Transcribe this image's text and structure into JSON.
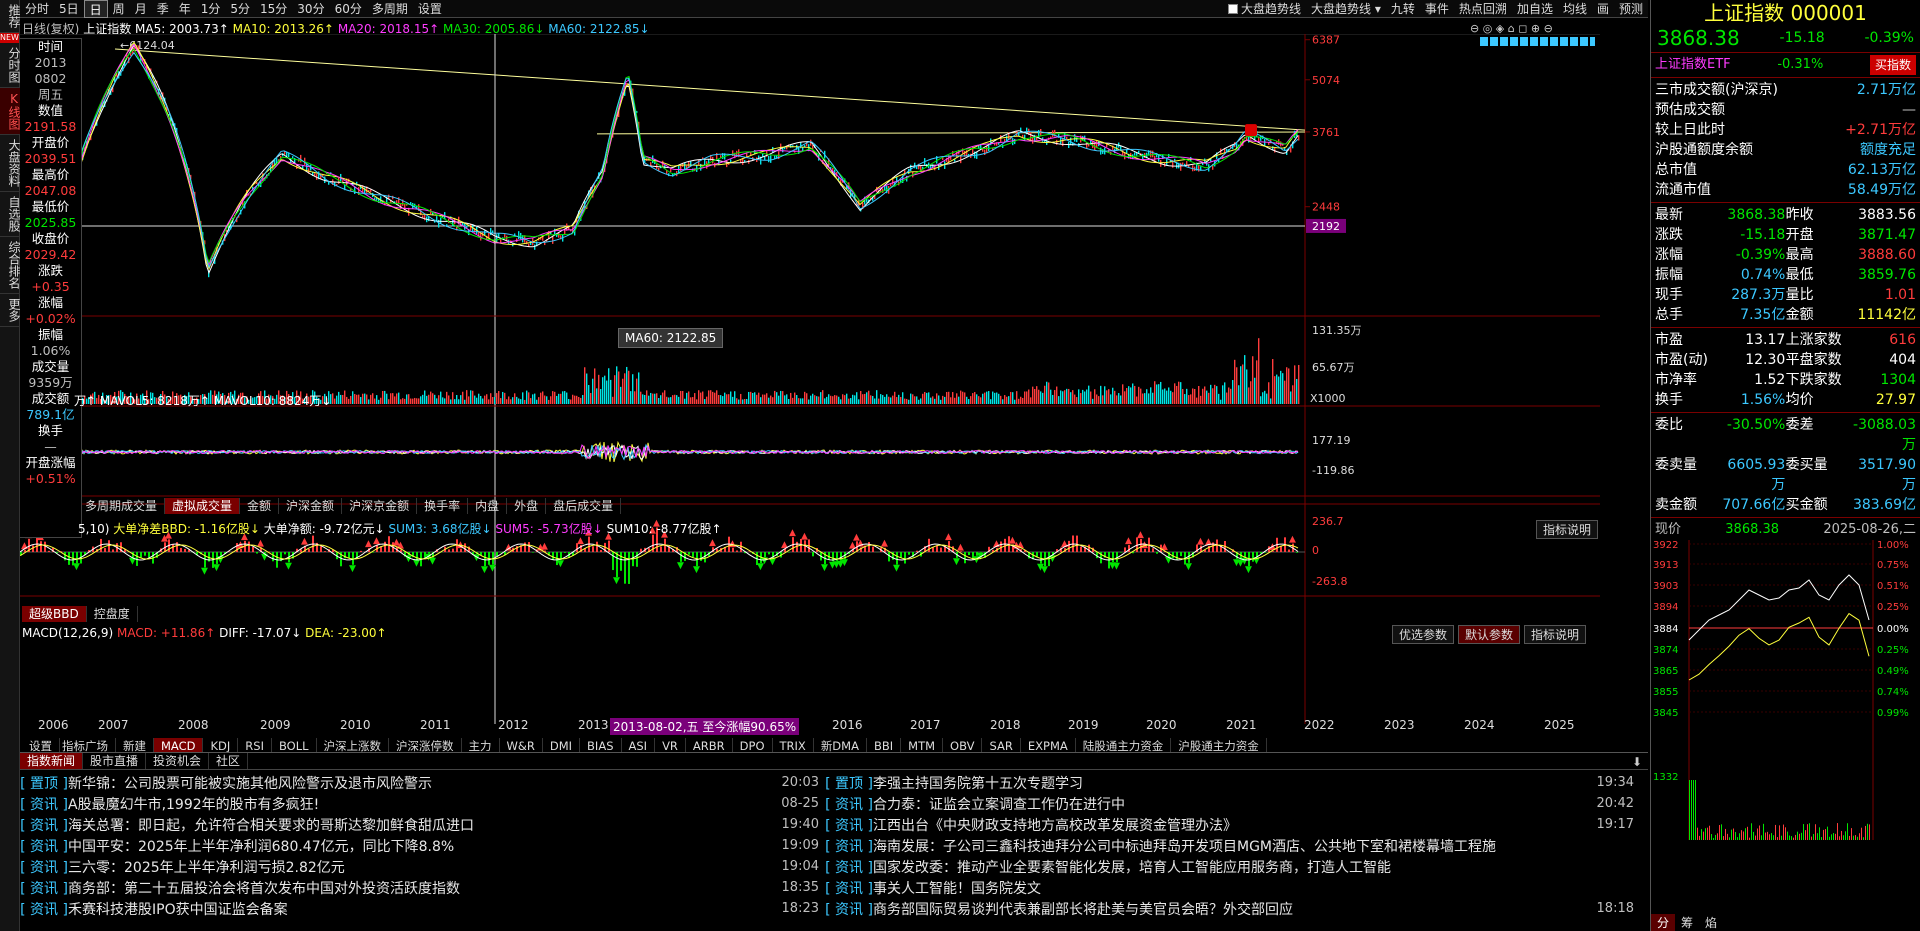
{
  "left_bar": [
    {
      "label": "推荐",
      "active": false
    },
    {
      "label": "分时图",
      "active": false
    },
    {
      "label": "K线图",
      "active": true
    },
    {
      "label": "大盘资料",
      "active": false
    },
    {
      "label": "自选股",
      "active": false
    },
    {
      "label": "综合排名",
      "active": false
    },
    {
      "label": "更多",
      "active": false
    }
  ],
  "left_bar_new_badge": "NEW",
  "top_bar": {
    "periods": [
      "分时",
      "5日",
      "日",
      "周",
      "月",
      "季",
      "年",
      "1分",
      "5分",
      "15分",
      "30分",
      "60分",
      "多周期",
      "设置"
    ],
    "active_period": "日",
    "right_items": [
      "大盘趋势线",
      "大盘趋势线 ▾",
      "九转",
      "事件",
      "热点回溯",
      "加自选",
      "均线",
      "画",
      "预测"
    ],
    "checkbox_label": "大盘趋势线"
  },
  "price_legend": {
    "mode": "日线(复权)",
    "name": "上证指数",
    "ma5": "MA5: 2003.73↑",
    "ma10": "MA10: 2013.26↑",
    "ma20": "MA20: 2018.15↑",
    "ma30": "MA30: 2005.86↓",
    "ma60": "MA60: 2122.85↓"
  },
  "info_panel": [
    {
      "label": "时间",
      "value": "2013",
      "color": "gray"
    },
    {
      "label": "",
      "value": "0802",
      "color": "gray"
    },
    {
      "label": "",
      "value": "周五",
      "color": "gray"
    },
    {
      "label": "数值",
      "value": "2191.58",
      "color": "red"
    },
    {
      "label": "开盘价",
      "value": "2039.51",
      "color": "red"
    },
    {
      "label": "最高价",
      "value": "2047.08",
      "color": "red"
    },
    {
      "label": "最低价",
      "value": "2025.85",
      "color": "green"
    },
    {
      "label": "收盘价",
      "value": "2029.42",
      "color": "red"
    },
    {
      "label": "涨跌",
      "value": "+0.35",
      "color": "red"
    },
    {
      "label": "涨幅",
      "value": "+0.02%",
      "color": "red"
    },
    {
      "label": "振幅",
      "value": "1.06%",
      "color": "gray"
    },
    {
      "label": "成交量",
      "value": "9359万",
      "color": "gray"
    },
    {
      "label": "成交额",
      "value": "789.1亿",
      "color": "cyan"
    },
    {
      "label": "换手",
      "value": "—",
      "color": "gray"
    },
    {
      "label": "开盘涨幅",
      "value": "+0.51%",
      "color": "red"
    }
  ],
  "price_axis": [
    "6387",
    "5074",
    "3761",
    "2448"
  ],
  "price_axis_marker": "2192",
  "peak_label": "6124.04",
  "tooltip": "MA60: 2122.85",
  "volume_legend": {
    "prefix": "万↑",
    "mavol5": "MAVOL5: 8218万↑",
    "mavol10": "MAVOL10: 8824万↓"
  },
  "volume_axis": [
    "131.35万",
    "65.67万"
  ],
  "volume_axis_unit": "X1000",
  "volume_tabs": [
    "多周期成交量",
    "虚拟成交量",
    "金额",
    "沪深金额",
    "沪深京金额",
    "换手率",
    "内盘",
    "外盘",
    "盘后成交量"
  ],
  "volume_tab_selected": "虚拟成交量",
  "bbd_legend": {
    "params": "5,10)",
    "main": "大单净差BBD: -1.16亿股↓",
    "big": "大单净额: -9.72亿元↓",
    "sum3": "SUM3: 3.68亿股↓",
    "sum5": "SUM5: -5.73亿股↓",
    "sum10": "SUM10: -8.77亿股↑"
  },
  "bbd_axis": [
    "177.19",
    "-119.86"
  ],
  "bbd_tabs": [
    "超级BBD",
    "控盘度"
  ],
  "bbd_btn": "指标说明",
  "macd_legend": {
    "name": "MACD(12,26,9)",
    "macd": "MACD: +11.86↑",
    "diff": "DIFF: -17.07↓",
    "dea": "DEA: -23.00↑"
  },
  "macd_axis": [
    "236.7",
    "0",
    "-263.8"
  ],
  "macd_buttons": [
    "优选参数",
    "默认参数",
    "指标说明"
  ],
  "years": [
    "2006",
    "2007",
    "2008",
    "2009",
    "2010",
    "2011",
    "2012",
    "2013",
    "2016",
    "2017",
    "2018",
    "2019",
    "2020",
    "2021",
    "2022",
    "2023",
    "2024",
    "2025"
  ],
  "year_highlight": "2013-08-02,五 至今涨幅90.65%",
  "indicator_tabs": [
    "设置",
    "指标广场",
    "新建",
    "MACD",
    "KDJ",
    "RSI",
    "BOLL",
    "沪深上涨数",
    "沪深涨停数",
    "主力",
    "W&R",
    "DMI",
    "BIAS",
    "ASI",
    "VR",
    "ARBR",
    "DPO",
    "TRIX",
    "新DMA",
    "BBI",
    "MTM",
    "OBV",
    "SAR",
    "EXPMA",
    "陆股通主力资金",
    "沪股通主力资金"
  ],
  "indicator_selected": "MACD",
  "news_tabs": [
    "指数新闻",
    "股市直播",
    "投资机会",
    "社区"
  ],
  "news_left": [
    {
      "tag": "置顶",
      "title": "新华锦：公司股票可能被实施其他风险警示及退市风险警示",
      "time": "20:03"
    },
    {
      "tag": "资讯",
      "title": "A股最魔幻牛市,1992年的股市有多疯狂!",
      "time": "08-25"
    },
    {
      "tag": "资讯",
      "title": "海关总署：即日起，允许符合相关要求的哥斯达黎加鲜食甜瓜进口",
      "time": "19:40"
    },
    {
      "tag": "资讯",
      "title": "中国平安：2025年上半年净利润680.47亿元，同比下降8.8%",
      "time": "19:09"
    },
    {
      "tag": "资讯",
      "title": "三六零：2025年上半年净利润亏损2.82亿元",
      "time": "19:04"
    },
    {
      "tag": "资讯",
      "title": "商务部：第二十五届投洽会将首次发布中国对外投资活跃度指数",
      "time": "18:35"
    },
    {
      "tag": "资讯",
      "title": "禾赛科技港股IPO获中国证监会备案",
      "time": "18:23"
    }
  ],
  "news_right": [
    {
      "tag": "置顶",
      "title": "李强主持国务院第十五次专题学习",
      "time": "19:34"
    },
    {
      "tag": "资讯",
      "title": "合力泰：证监会立案调查工作仍在进行中",
      "time": "20:42"
    },
    {
      "tag": "资讯",
      "title": "江西出台《中央财政支持地方高校改革发展资金管理办法》",
      "time": "19:17"
    },
    {
      "tag": "资讯",
      "title": "海南发展：子公司三鑫科技迪拜分公司中标迪拜岛开发项目MGM酒店、公共地下室和裙楼幕墙工程施",
      "time": ""
    },
    {
      "tag": "资讯",
      "title": "国家发改委：推动产业全要素智能化发展，培育人工智能应用服务商，打造人工智能",
      "time": ""
    },
    {
      "tag": "资讯",
      "title": "事关人工智能！国务院发文",
      "time": ""
    },
    {
      "tag": "资讯",
      "title": "商务部国际贸易谈判代表兼副部长将赴美与美官员会晤？外交部回应",
      "time": "18:18"
    }
  ],
  "right_panel": {
    "title": "上证指数 000001",
    "price": "3868.38",
    "change": "-15.18",
    "pct": "-0.39%",
    "etf_name": "上证指数ETF",
    "etf_pct": "-0.31%",
    "etf_btn": "买指数",
    "stats_top": [
      {
        "k": "三市成交额(沪深京)",
        "v": "2.71万亿",
        "c": "cyan"
      },
      {
        "k": "预估成交额",
        "v": "—",
        "c": "gray"
      },
      {
        "k": "较上日此时",
        "v": "+2.71万亿",
        "c": "red"
      },
      {
        "k": "沪股通额度余额",
        "v": "额度充足",
        "c": "cyan"
      },
      {
        "k": "总市值",
        "v": "62.13万亿",
        "c": "cyan"
      },
      {
        "k": "流通市值",
        "v": "58.49万亿",
        "c": "cyan"
      }
    ],
    "quote": [
      [
        "最新",
        "3868.38",
        "green",
        "昨收",
        "3883.56",
        "white"
      ],
      [
        "涨跌",
        "-15.18",
        "green",
        "开盘",
        "3871.47",
        "green"
      ],
      [
        "涨幅",
        "-0.39%",
        "green",
        "最高",
        "3888.60",
        "red"
      ],
      [
        "振幅",
        "0.74%",
        "cyan",
        "最低",
        "3859.76",
        "green"
      ],
      [
        "现手",
        "287.3万",
        "cyan",
        "量比",
        "1.01",
        "red"
      ],
      [
        "总手",
        "7.35亿",
        "cyan",
        "金额",
        "11142亿",
        "yellow"
      ]
    ],
    "breadth": [
      [
        "市盈",
        "13.17",
        "white",
        "上涨家数",
        "616",
        "red"
      ],
      [
        "市盈(动)",
        "12.30",
        "white",
        "平盘家数",
        "404",
        "white"
      ],
      [
        "市净率",
        "1.52",
        "white",
        "下跌家数",
        "1304",
        "green"
      ],
      [
        "换手",
        "1.56%",
        "cyan",
        "均价",
        "27.97",
        "yellow"
      ]
    ],
    "order": [
      [
        "委比",
        "-30.50%",
        "green",
        "委差",
        "-3088.03万",
        "green"
      ],
      [
        "委卖量",
        "6605.93万",
        "cyan",
        "委买量",
        "3517.90万",
        "cyan"
      ],
      [
        "卖金额",
        "707.66亿",
        "cyan",
        "买金额",
        "383.69亿",
        "cyan"
      ]
    ],
    "current_label": "现价",
    "current_value": "3868.38",
    "date": "2025-08-26,二",
    "mini_left_axis": [
      "3922",
      "3913",
      "3903",
      "3894",
      "3884",
      "3874",
      "3865",
      "3855",
      "3845",
      "1332"
    ],
    "mini_right_axis": [
      "1.00%",
      "0.75%",
      "0.51%",
      "0.25%",
      "0.00%",
      "0.25%",
      "0.49%",
      "0.74%",
      "0.99%"
    ],
    "bottom_tabs": [
      "分",
      "筹",
      "焰"
    ]
  }
}
